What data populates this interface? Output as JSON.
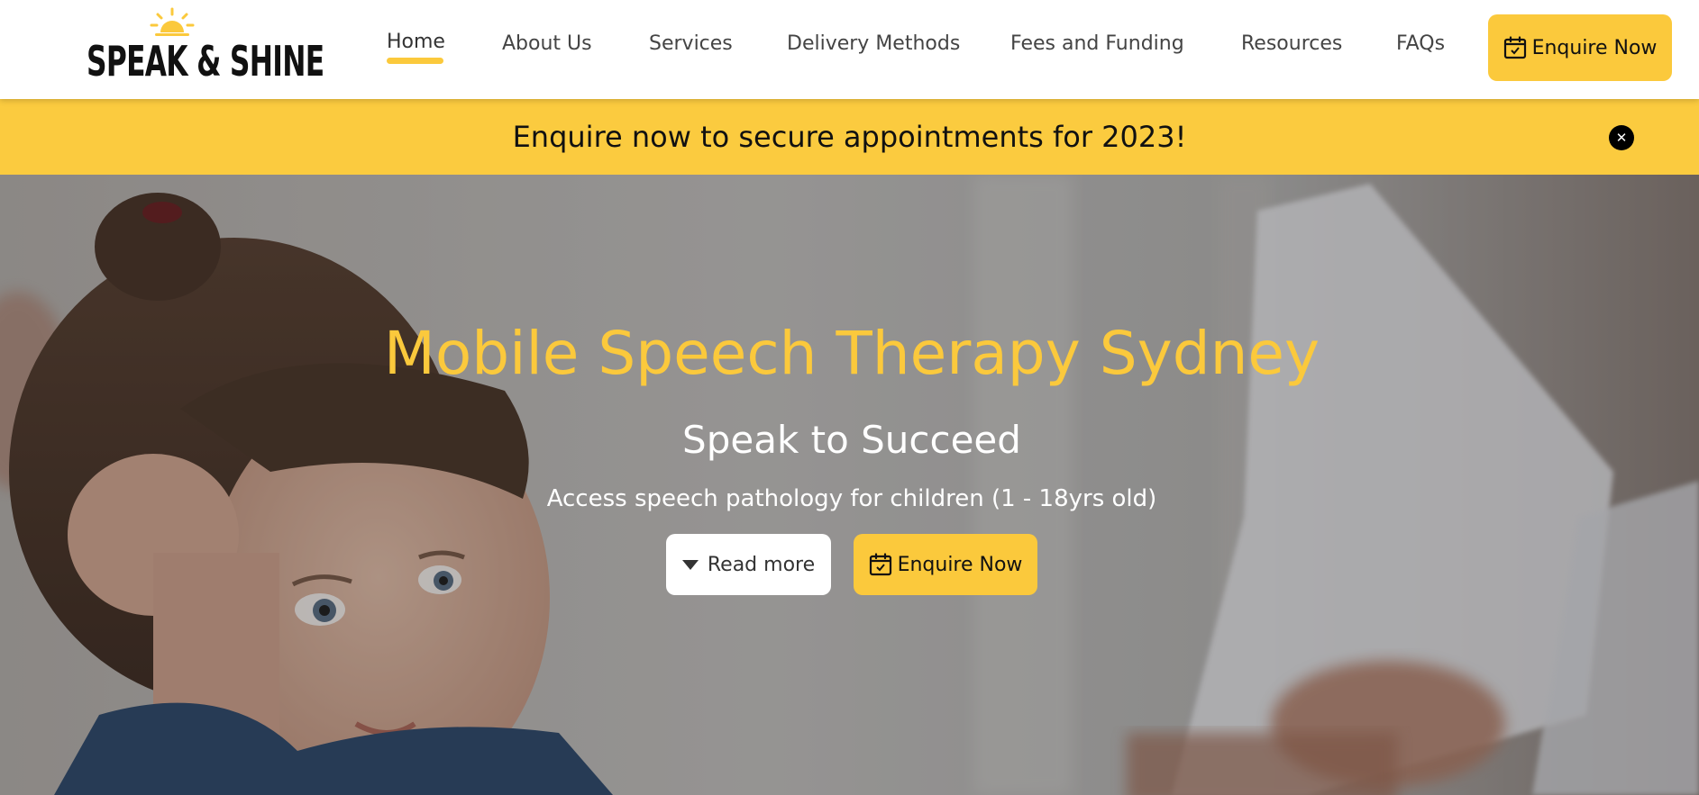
{
  "brand": {
    "logo_text": "SPEAK & SHINE",
    "accent_color": "#fbc93c",
    "logo_icon": "sun-icon"
  },
  "nav": {
    "items": [
      {
        "label": "Home",
        "active": true
      },
      {
        "label": "About Us"
      },
      {
        "label": "Services"
      },
      {
        "label": "Delivery Methods"
      },
      {
        "label": "Fees and Funding"
      },
      {
        "label": "Resources"
      },
      {
        "label": "FAQs"
      }
    ],
    "cta_label": "Enquire Now",
    "cta_icon": "calendar-check-icon"
  },
  "announcement": {
    "text": "Enquire now to secure appointments for 2023!",
    "close_icon": "close-icon",
    "background": "#fbcb3f"
  },
  "hero": {
    "title": "Mobile Speech Therapy Sydney",
    "subtitle": "Speak to Succeed",
    "description": "Access speech pathology for children (1 - 18yrs old)",
    "read_more_label": "Read more",
    "read_more_icon": "caret-down-icon",
    "enquire_label": "Enquire Now",
    "enquire_icon": "calendar-check-icon",
    "background_image": "girl-leaning-on-hand-photo"
  }
}
